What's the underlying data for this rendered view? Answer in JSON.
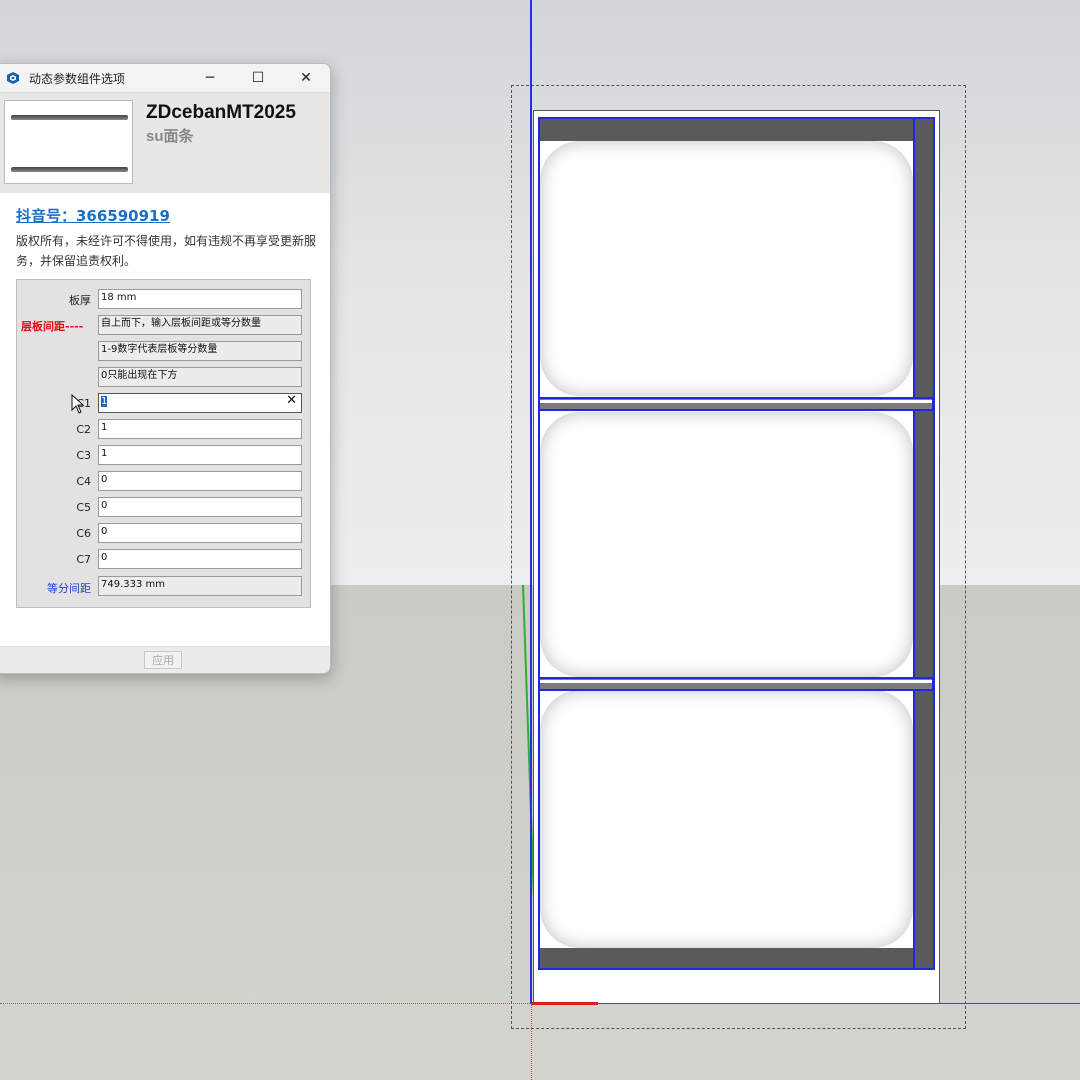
{
  "dialog": {
    "title": "动态参数组件选项",
    "window_buttons": {
      "minimize": "─",
      "maximize": "☐",
      "close": "✕"
    },
    "component_name": "ZDcebanMT2025",
    "component_subtitle": "su面条",
    "douyin_link": "抖音号：366590919",
    "copyright": "版权所有，未经许可不得使用，如有违规不再享受更新服务，并保留追责权利。",
    "apply_button": "应用"
  },
  "form": {
    "thickness": {
      "label": "板厚",
      "value": "18 mm"
    },
    "spacing": {
      "label": "层板间距----"
    },
    "hints": [
      "自上而下，输入层板间距或等分数量",
      "1-9数字代表层板等分数量",
      "0只能出现在下方"
    ],
    "c_fields": [
      {
        "label": "C1",
        "value": "1"
      },
      {
        "label": "C2",
        "value": "1"
      },
      {
        "label": "C3",
        "value": "1"
      },
      {
        "label": "C4",
        "value": "0"
      },
      {
        "label": "C5",
        "value": "0"
      },
      {
        "label": "C6",
        "value": "0"
      },
      {
        "label": "C7",
        "value": "0"
      }
    ],
    "equal_spacing": {
      "label": "等分间距",
      "value": "749.333 mm"
    },
    "clear_icon": "✕"
  },
  "icons": {
    "app": "sketchup-logo-icon",
    "cursor": "mouse-pointer-icon",
    "clear": "clear-icon"
  },
  "colors": {
    "link": "#1d6fc0",
    "required_label": "#e01010",
    "info_label": "#2240c8",
    "selection_edges": "#1f2ae0"
  }
}
